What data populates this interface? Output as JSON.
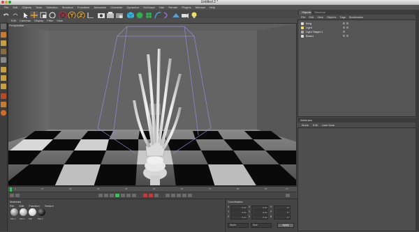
{
  "window": {
    "title": "Untitled 2 *",
    "traffic_colors": [
      "#e0443e",
      "#dea123",
      "#1aab29"
    ]
  },
  "menubar": {
    "items": [
      "File",
      "Edit",
      "Objects",
      "Tools",
      "Selection",
      "Structure",
      "Functions",
      "Animation",
      "Character",
      "Dynamics",
      "MoGraph",
      "Hair",
      "Render",
      "Plugins",
      "Window",
      "Help"
    ]
  },
  "toolbar": {
    "icons": [
      "undo-icon",
      "redo-icon",
      "live-selection-icon",
      "move-icon",
      "scale-icon",
      "rotate-icon",
      "x-axis-icon",
      "y-axis-icon",
      "z-axis-icon",
      "coordinate-system-icon",
      "render-view-icon",
      "render-picture-viewer-icon",
      "render-settings-icon",
      "cube-icon",
      "subdivision-icon",
      "array-icon",
      "spline-pen-icon",
      "deformer-icon",
      "environment-icon",
      "camera-icon",
      "light-icon"
    ]
  },
  "left_toolbar": {
    "icons": [
      "make-editable-icon",
      "model-mode-icon",
      "object-mode-icon",
      "texture-mode-icon",
      "workplane-icon",
      "points-mode-icon",
      "edges-mode-icon",
      "polygons-mode-icon",
      "snap-icon",
      "lock-icon",
      "soft-selection-icon"
    ]
  },
  "viewport": {
    "menu": [
      "Edit",
      "Cameras",
      "Display",
      "Filter",
      "View"
    ],
    "label": "Perspective"
  },
  "timeline": {
    "ticks": [
      "0",
      "10",
      "20",
      "30",
      "40",
      "50",
      "60",
      "70",
      "80",
      "90"
    ],
    "end_frame": "0 F"
  },
  "material_manager": {
    "title": "Materials",
    "menu": [
      "File",
      "Edit",
      "Function",
      "Texture"
    ],
    "materials": [
      {
        "name": "Mat.2",
        "color": "#8a8a8a"
      },
      {
        "name": "Mat.1",
        "color": "#b0b0b0"
      },
      {
        "name": "Mat",
        "color": "#d8d8d8"
      },
      {
        "name": "Mat.3",
        "color": "#202020"
      }
    ]
  },
  "coordinates": {
    "title": "Coordinates",
    "rows": [
      {
        "axis": "X",
        "pos": "0 cm",
        "axis2": "X",
        "size": "0 cm",
        "rot": "H",
        "rval": "0 °"
      },
      {
        "axis": "Y",
        "pos": "0 cm",
        "axis2": "Y",
        "size": "0 cm",
        "rot": "P",
        "rval": "0 °"
      },
      {
        "axis": "Z",
        "pos": "0 cm",
        "axis2": "Z",
        "size": "0 cm",
        "rot": "B",
        "rval": "0 °"
      }
    ],
    "mode_select": "World",
    "size_select": "Size",
    "apply_label": "Apply"
  },
  "object_manager": {
    "tabs": [
      "Objects",
      "Structure"
    ],
    "menu": [
      "File",
      "Edit",
      "View",
      "Objects",
      "Tags",
      "Bookmarks"
    ],
    "objects": [
      "King",
      "Light",
      "Light Target.1",
      "Board"
    ]
  },
  "attribute_manager": {
    "title": "Attributes",
    "menu": [
      "Mode",
      "Edit",
      "User Data"
    ]
  }
}
